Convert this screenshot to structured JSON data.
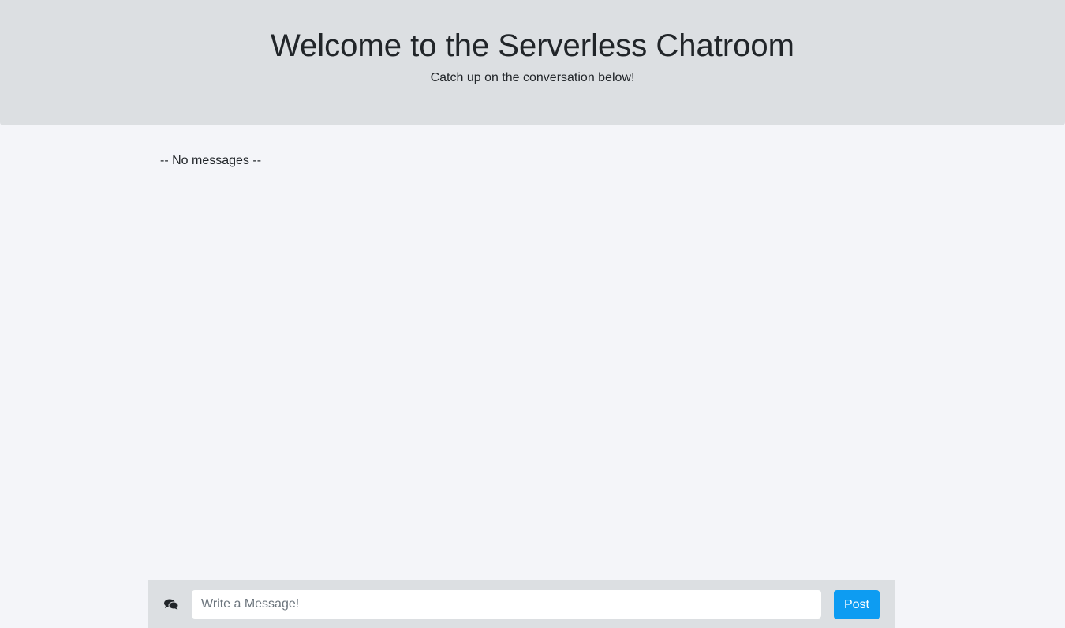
{
  "header": {
    "title": "Welcome to the Serverless Chatroom",
    "subtitle": "Catch up on the conversation below!"
  },
  "messages": {
    "empty_text": "-- No messages --"
  },
  "composer": {
    "icon": "comments-icon",
    "placeholder": "Write a Message!",
    "value": "",
    "post_label": "Post",
    "accent": "#0d9cf2"
  }
}
